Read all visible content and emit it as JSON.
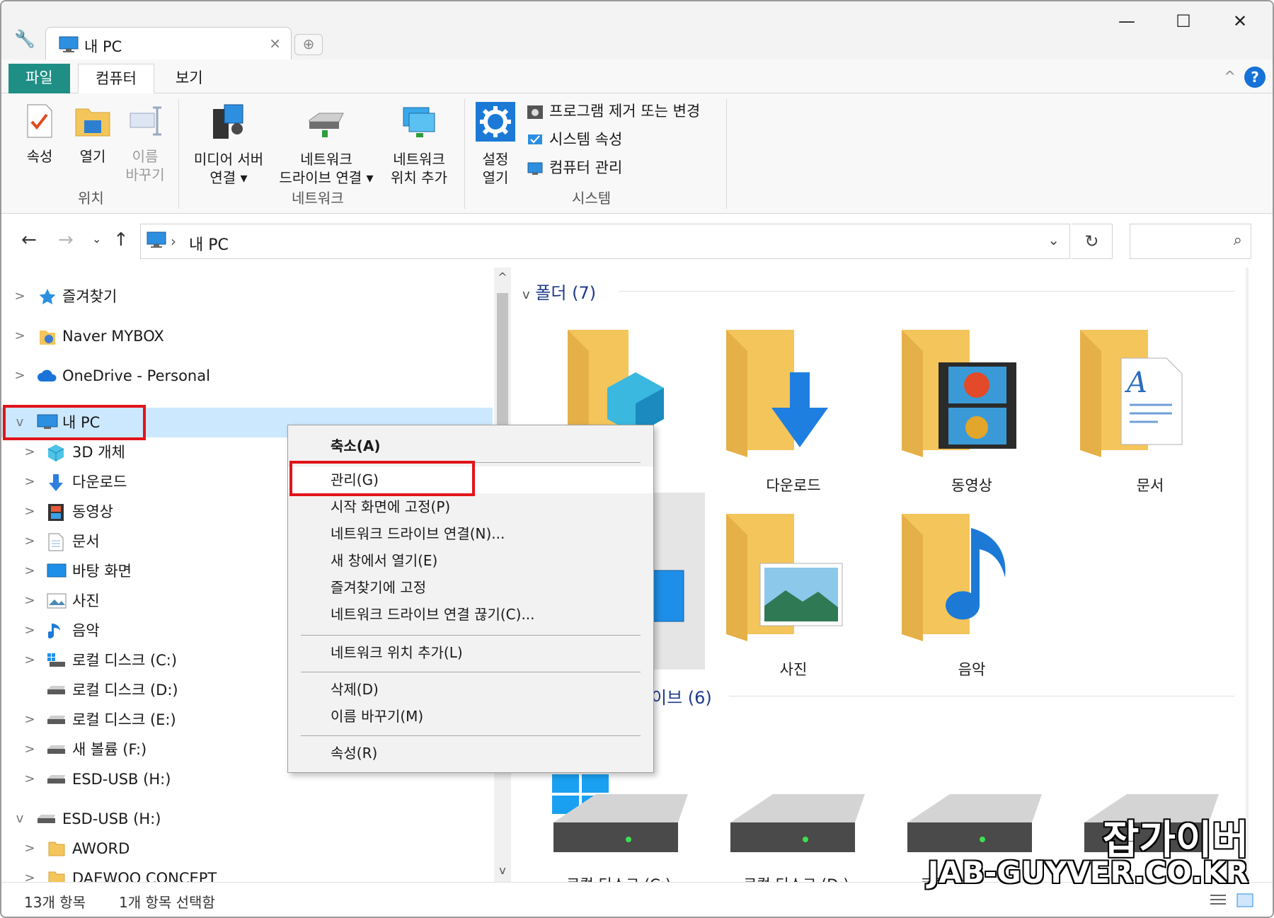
{
  "window": {
    "tab_title": "내 PC",
    "tab_close": "×",
    "new_tab": "⊕",
    "minimize": "—",
    "maximize": "☐",
    "close": "✕"
  },
  "ribbon_tabs": [
    "파일",
    "컴퓨터",
    "보기"
  ],
  "ribbon": {
    "location": {
      "label": "위치",
      "properties": "속성",
      "open": "열기",
      "rename": [
        "이름",
        "바꾸기"
      ]
    },
    "network": {
      "label": "네트워크",
      "media_server": [
        "미디어 서버",
        "연결 ▾"
      ],
      "map_drive": [
        "네트워크",
        "드라이브 연결 ▾"
      ],
      "add_location": [
        "네트워크",
        "위치 추가"
      ]
    },
    "system": {
      "label": "시스템",
      "settings": [
        "설정",
        "열기"
      ],
      "uninstall": "프로그램 제거 또는 변경",
      "system_props": "시스템 속성",
      "computer_mgmt": "컴퓨터 관리"
    }
  },
  "address": {
    "path": "내 PC",
    "separator": "›"
  },
  "nav": {
    "items": [
      {
        "label": "즐겨찾기",
        "chev": ">"
      },
      {
        "label": "Naver MYBOX",
        "chev": ">"
      },
      {
        "label": "OneDrive - Personal",
        "chev": ">"
      },
      {
        "label": "내 PC",
        "chev": "v"
      },
      {
        "label": "3D 개체",
        "chev": ">"
      },
      {
        "label": "다운로드",
        "chev": ">"
      },
      {
        "label": "동영상",
        "chev": ">"
      },
      {
        "label": "문서",
        "chev": ">"
      },
      {
        "label": "바탕 화면",
        "chev": ">"
      },
      {
        "label": "사진",
        "chev": ">"
      },
      {
        "label": "음악",
        "chev": ">"
      },
      {
        "label": "로컬 디스크 (C:)",
        "chev": ">"
      },
      {
        "label": "로컬 디스크 (D:)",
        "chev": ""
      },
      {
        "label": "로컬 디스크 (E:)",
        "chev": ">"
      },
      {
        "label": "새 볼륨 (F:)",
        "chev": ">"
      },
      {
        "label": "ESD-USB (H:)",
        "chev": ">"
      },
      {
        "label": "ESD-USB (H:)",
        "chev": "v"
      },
      {
        "label": "AWORD",
        "chev": ">"
      },
      {
        "label": "DAEWOO CONCEPT",
        "chev": ">"
      }
    ]
  },
  "content": {
    "folders_header": "폴더 (7)",
    "drives_header": "이브 (6)",
    "folders": [
      "다운로드",
      "동영상",
      "문서",
      "사진",
      "음악"
    ],
    "drive_labels": [
      "로컬 디스크 (C:)",
      "로컬 디스크 (D:)",
      "로컬"
    ]
  },
  "context_menu": {
    "items": [
      "축소(A)",
      "관리(G)",
      "시작 화면에 고정(P)",
      "네트워크 드라이브 연결(N)...",
      "새 창에서 열기(E)",
      "즐겨찾기에 고정",
      "네트워크 드라이브 연결 끊기(C)...",
      "네트워크 위치 추가(L)",
      "삭제(D)",
      "이름 바꾸기(M)",
      "속성(R)"
    ]
  },
  "status": {
    "count": "13개 항목",
    "selected": "1개 항목 선택함"
  },
  "watermark": {
    "line1": "잡가이버",
    "line2": "JAB-GUYVER.CO.KR"
  },
  "colors": {
    "file_tab": "#1f8f86",
    "selection": "#cce8ff",
    "highlight_box": "#e2141a",
    "folder": "#f4c55a"
  }
}
